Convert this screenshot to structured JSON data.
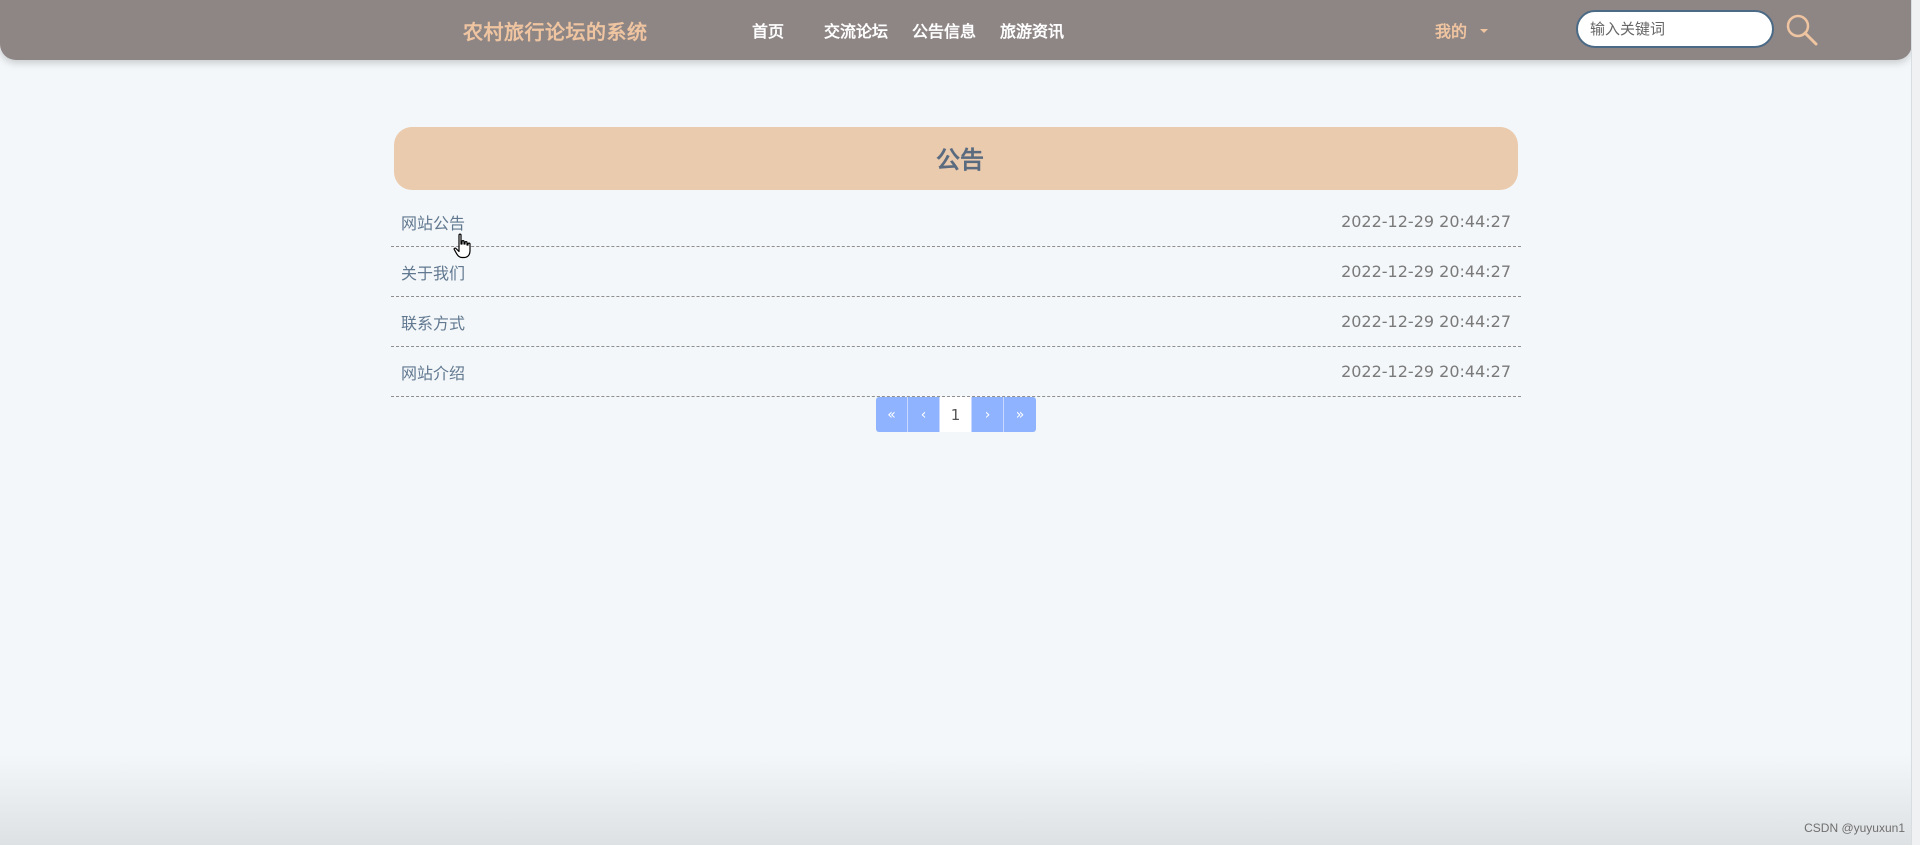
{
  "header": {
    "brand": "农村旅行论坛的系统",
    "nav": [
      {
        "label": "首页"
      },
      {
        "label": "交流论坛"
      },
      {
        "label": "公告信息"
      },
      {
        "label": "旅游资讯"
      }
    ],
    "user_menu_label": "我的",
    "search": {
      "placeholder": "输入关键词",
      "value": ""
    },
    "icons": {
      "search": "search-icon",
      "dropdown": "caret-down-icon"
    }
  },
  "notice_panel": {
    "title": "公告"
  },
  "notices": [
    {
      "title": "网站公告",
      "time": "2022-12-29 20:44:27"
    },
    {
      "title": "关于我们",
      "time": "2022-12-29 20:44:27"
    },
    {
      "title": "联系方式",
      "time": "2022-12-29 20:44:27"
    },
    {
      "title": "网站介绍",
      "time": "2022-12-29 20:44:27"
    }
  ],
  "pagination": {
    "first": "«",
    "prev": "‹",
    "current": "1",
    "next": "›",
    "last": "»"
  },
  "watermark": "CSDN @yuyuxun1",
  "colors": {
    "header_bg": "#8e8585",
    "brand": "#efc4a0",
    "panel_bg": "#ebcbad",
    "page_bg": "#f3f7f9",
    "pagination": "#8fb3ff"
  }
}
